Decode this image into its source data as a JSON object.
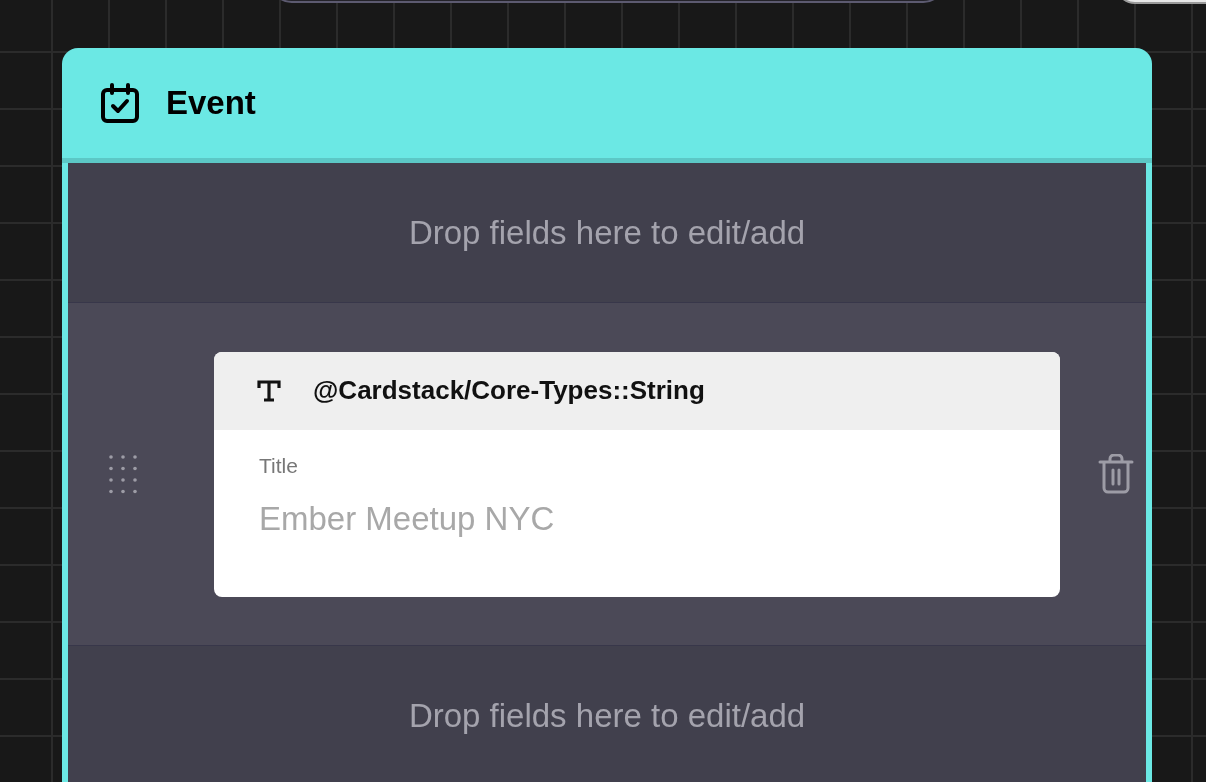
{
  "card": {
    "title": "Event"
  },
  "sections": [
    {
      "kind": "dropzone",
      "text": "Drop fields here to edit/add"
    },
    {
      "kind": "field",
      "type_label": "@Cardstack/Core-Types::String",
      "label": "Title",
      "value": "Ember Meetup NYC"
    },
    {
      "kind": "dropzone",
      "text": "Drop fields here to edit/add"
    }
  ]
}
